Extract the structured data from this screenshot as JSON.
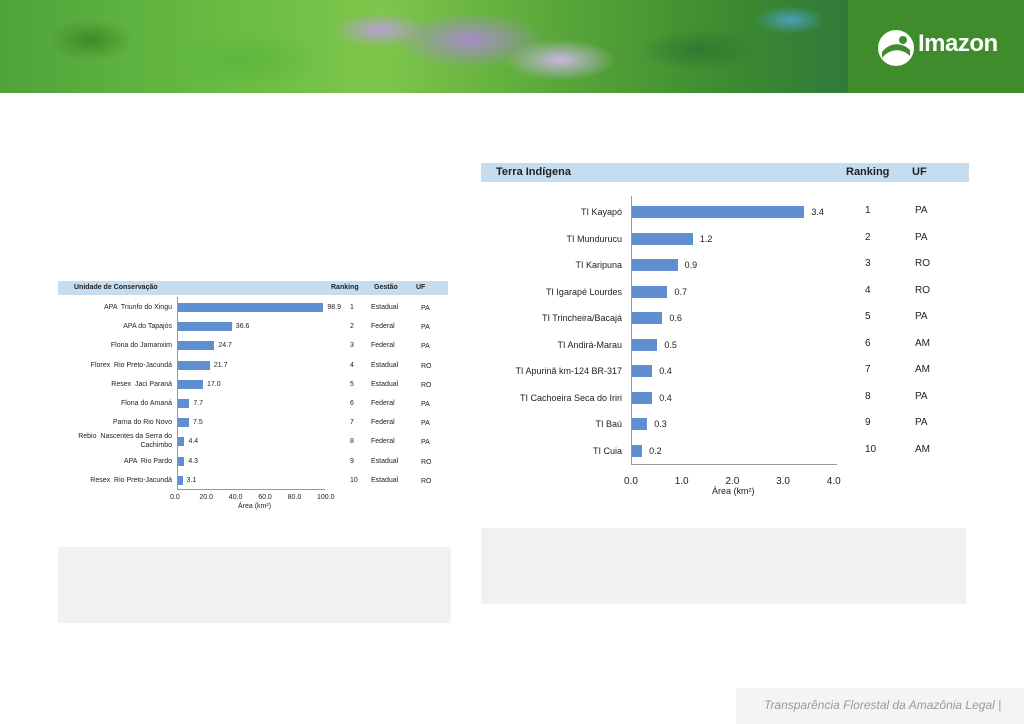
{
  "brand": {
    "name": "Imazon"
  },
  "left_table": {
    "headers": [
      "Unidade de Conservação",
      "Ranking",
      "Gestão",
      "UF"
    ],
    "rows": [
      {
        "name": "APA  Triunfo do Xingu",
        "value": "98.9",
        "rank": "1",
        "gestao": "Estadual",
        "uf": "PA"
      },
      {
        "name": "APA do Tapajós",
        "value": "36.6",
        "rank": "2",
        "gestao": "Federal",
        "uf": "PA"
      },
      {
        "name": "Flona do Jamanxim",
        "value": "24.7",
        "rank": "3",
        "gestao": "Federal",
        "uf": "PA"
      },
      {
        "name": "Florex  Rio Preto-Jacundá",
        "value": "21.7",
        "rank": "4",
        "gestao": "Estadual",
        "uf": "RO"
      },
      {
        "name": "Resex  Jaci Paraná",
        "value": "17.0",
        "rank": "5",
        "gestao": "Estadual",
        "uf": "RO"
      },
      {
        "name": "Flona do Amaná",
        "value": "7.7",
        "rank": "6",
        "gestao": "Federal",
        "uf": "PA"
      },
      {
        "name": "Parna do Rio Novo",
        "value": "7.5",
        "rank": "7",
        "gestao": "Federal",
        "uf": "PA"
      },
      {
        "name": "Rebio  Nascentes da Serra do\nCachimbo",
        "value": "4.4",
        "rank": "8",
        "gestao": "Federal",
        "uf": "PA"
      },
      {
        "name": "APA  Rio Pardo",
        "value": "4.3",
        "rank": "9",
        "gestao": "Estadual",
        "uf": "RO"
      },
      {
        "name": "Resex  Rio Preto-Jacundá",
        "value": "3.1",
        "rank": "10",
        "gestao": "Estadual",
        "uf": "RO"
      }
    ],
    "x_ticks": [
      "0.0",
      "20.0",
      "40.0",
      "60.0",
      "80.0",
      "100.0"
    ],
    "x_label": "Área (km²)"
  },
  "right_table": {
    "headers": [
      "Terra Indígena",
      "Ranking",
      "UF"
    ],
    "rows": [
      {
        "name": "TI Kayapó",
        "value": "3.4",
        "rank": "1",
        "uf": "PA"
      },
      {
        "name": "TI Mundurucu",
        "value": "1.2",
        "rank": "2",
        "uf": "PA"
      },
      {
        "name": "TI Karipuna",
        "value": "0.9",
        "rank": "3",
        "uf": "RO"
      },
      {
        "name": "TI Igarapé Lourdes",
        "value": "0.7",
        "rank": "4",
        "uf": "RO"
      },
      {
        "name": "TI Trincheira/Bacajá",
        "value": "0.6",
        "rank": "5",
        "uf": "PA"
      },
      {
        "name": "TI Andirá-Marau",
        "value": "0.5",
        "rank": "6",
        "uf": "AM"
      },
      {
        "name": "TI Apurinã km-124 BR-317",
        "value": "0.4",
        "rank": "7",
        "uf": "AM"
      },
      {
        "name": "TI Cachoeira Seca do Iriri",
        "value": "0.4",
        "rank": "8",
        "uf": "PA"
      },
      {
        "name": "TI Baú",
        "value": "0.3",
        "rank": "9",
        "uf": "PA"
      },
      {
        "name": "TI Cuia",
        "value": "0.2",
        "rank": "10",
        "uf": "AM"
      }
    ],
    "x_ticks": [
      "0.0",
      "1.0",
      "2.0",
      "3.0",
      "4.0"
    ],
    "x_label": "Área (km²)"
  },
  "footer": {
    "text": "Transparência Florestal da Amazônia Legal |"
  },
  "colors": {
    "bar": "#5f8fcf",
    "header": "#c6dcef",
    "brand_green": "#3e8c2b"
  },
  "chart_data": [
    {
      "type": "bar",
      "orientation": "horizontal",
      "categories": [
        "APA  Triunfo do Xingu",
        "APA do Tapajós",
        "Flona do Jamanxim",
        "Florex  Rio Preto-Jacundá",
        "Resex  Jaci Paraná",
        "Flona do Amaná",
        "Parna do Rio Novo",
        "Rebio  Nascentes da Serra do Cachimbo",
        "APA  Rio Pardo",
        "Resex  Rio Preto-Jacundá"
      ],
      "values": [
        98.9,
        36.6,
        24.7,
        21.7,
        17.0,
        7.7,
        7.5,
        4.4,
        4.3,
        3.1
      ],
      "xlabel": "Área (km²)",
      "xlim": [
        0,
        100
      ],
      "grid": false
    },
    {
      "type": "bar",
      "orientation": "horizontal",
      "categories": [
        "TI Kayapó",
        "TI Mundurucu",
        "TI Karipuna",
        "TI Igarapé Lourdes",
        "TI Trincheira/Bacajá",
        "TI Andirá-Marau",
        "TI Apurinã km-124 BR-317",
        "TI Cachoeira Seca do Iriri",
        "TI Baú",
        "TI Cuia"
      ],
      "values": [
        3.4,
        1.2,
        0.9,
        0.7,
        0.6,
        0.5,
        0.4,
        0.4,
        0.3,
        0.2
      ],
      "xlabel": "Área (km²)",
      "xlim": [
        0,
        4
      ],
      "grid": false
    }
  ]
}
